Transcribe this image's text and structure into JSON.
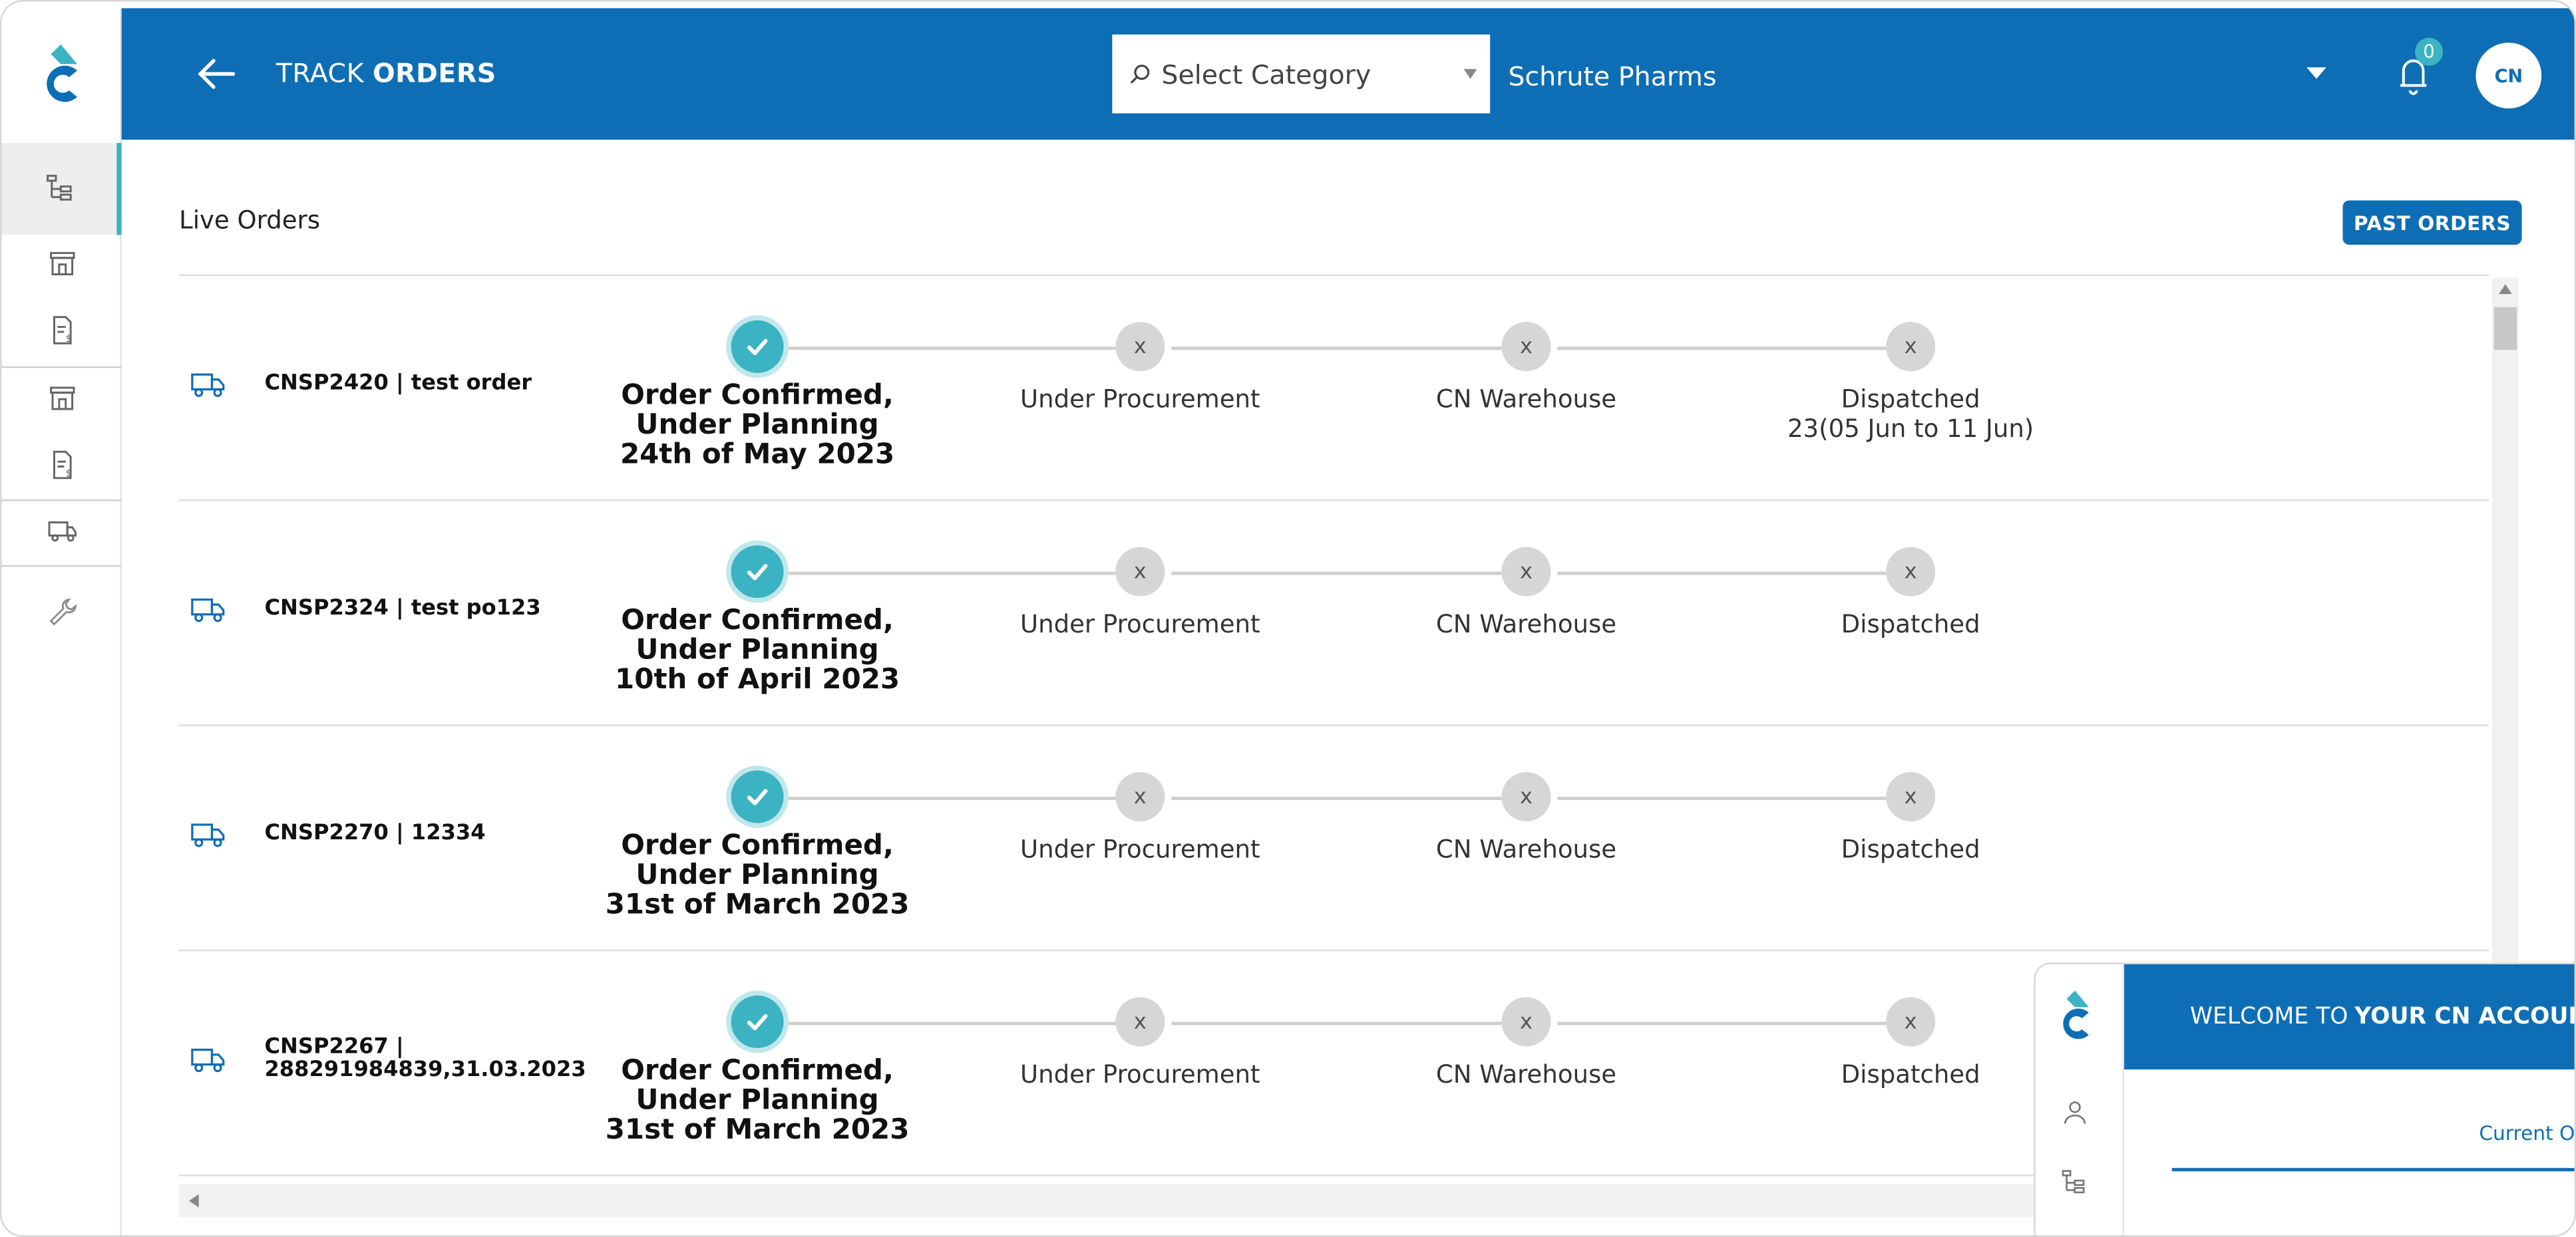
{
  "header": {
    "title_prefix": "TRACK",
    "title_bold": "ORDERS",
    "category_placeholder": "Select Category",
    "company": "Schrute Pharms",
    "notification_count": "0",
    "avatar_text": "CN",
    "colors": {
      "brand": "#0d6eb5",
      "accent": "#3bb3c3"
    }
  },
  "sidebar": {
    "items": [
      {
        "icon": "hierarchy-icon",
        "active": true
      },
      {
        "icon": "store-icon"
      },
      {
        "icon": "invoice-icon"
      },
      {
        "icon": "store-icon"
      },
      {
        "icon": "invoice-icon"
      },
      {
        "icon": "truck-icon"
      },
      {
        "icon": "wrench-icon"
      }
    ]
  },
  "main": {
    "section_title": "Live Orders",
    "past_orders_label": "PAST ORDERS",
    "step_mark_pending": "x",
    "orders": [
      {
        "id": "CNSP2420 | test order",
        "steps": [
          {
            "label": "Order Confirmed, Under Planning",
            "detail": "24th of May 2023",
            "done": true
          },
          {
            "label": "Under Procurement",
            "done": false
          },
          {
            "label": "CN Warehouse",
            "done": false
          },
          {
            "label": "Dispatched",
            "detail": "23(05 Jun to 11 Jun)",
            "done": false
          }
        ]
      },
      {
        "id": "CNSP2324 | test po123",
        "steps": [
          {
            "label": "Order Confirmed, Under Planning",
            "detail": "10th of April 2023",
            "done": true
          },
          {
            "label": "Under Procurement",
            "done": false
          },
          {
            "label": "CN Warehouse",
            "done": false
          },
          {
            "label": "Dispatched",
            "done": false
          }
        ]
      },
      {
        "id": "CNSP2270 | 12334",
        "steps": [
          {
            "label": "Order Confirmed, Under Planning",
            "detail": "31st of March 2023",
            "done": true
          },
          {
            "label": "Under Procurement",
            "done": false
          },
          {
            "label": "CN Warehouse",
            "done": false
          },
          {
            "label": "Dispatched",
            "done": false
          }
        ]
      },
      {
        "id": "CNSP2267 | 288291984839,31.03.2023",
        "steps": [
          {
            "label": "Order Confirmed, Under Planning",
            "detail": "31st of March 2023",
            "done": true
          },
          {
            "label": "Under Procurement",
            "done": false
          },
          {
            "label": "CN Warehouse",
            "done": false
          },
          {
            "label": "Dispatched",
            "done": false
          }
        ]
      }
    ]
  },
  "popup": {
    "welcome_prefix": "WELCOME TO",
    "welcome_bold": "YOUR CN ACCOUNT",
    "tab_label": "Current Orc"
  }
}
